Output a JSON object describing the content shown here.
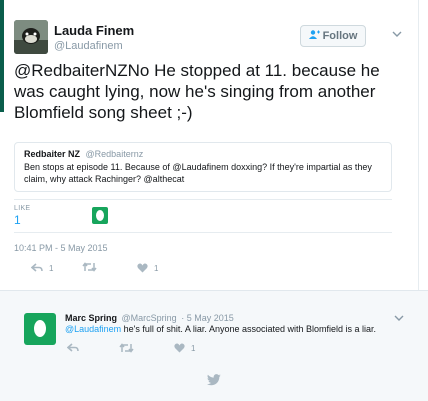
{
  "tweet": {
    "display_name": "Lauda Finem",
    "handle": "@Laudafinem",
    "follow_label": "Follow",
    "text": "@RedbaiterNZNo He stopped at 11. because he was caught lying, now he's singing from another Blomfield song sheet ;-)",
    "quote": {
      "display_name": "Redbaiter NZ",
      "handle": "@Redbaiternz",
      "text": "Ben stops at episode 11. Because of @Laudafinem doxxing? If they're impartial as they claim, why attack Rachinger? @althecat"
    },
    "likes": {
      "label": "LIKE",
      "count": "1"
    },
    "timestamp": "10:41 PM - 5 May 2015",
    "actions": {
      "reply_count": "1",
      "like_count": "1"
    }
  },
  "reply": {
    "display_name": "Marc Spring",
    "handle": "@MarcSpring",
    "date": "· 5 May 2015",
    "mention": "@Laudafinem",
    "text": " he's full of shit. A liar. Anyone associated with Blomfield is a liar.",
    "actions": {
      "like_count": "1"
    }
  },
  "colors": {
    "link": "#1da1f2",
    "egg_avatar": "#17a55c",
    "muted": "#8899a6"
  }
}
